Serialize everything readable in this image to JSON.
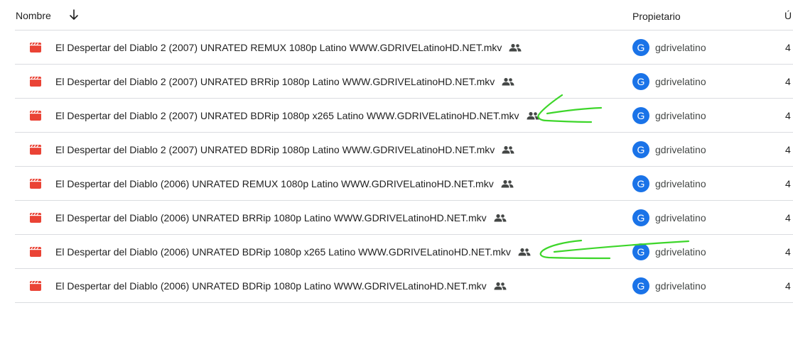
{
  "header": {
    "name_label": "Nombre",
    "sort_icon": "arrow-down-icon",
    "owner_label": "Propietario",
    "last_label": "Ú"
  },
  "files": [
    {
      "name": "El Despertar del Diablo 2 (2007) UNRATED REMUX 1080p Latino WWW.GDRIVELatinoHD.NET.mkv",
      "owner": "gdrivelatino",
      "avatar_letter": "G",
      "last": "4"
    },
    {
      "name": "El Despertar del Diablo 2 (2007) UNRATED BRRip 1080p Latino WWW.GDRIVELatinoHD.NET.mkv",
      "owner": "gdrivelatino",
      "avatar_letter": "G",
      "last": "4"
    },
    {
      "name": "El Despertar del Diablo 2 (2007) UNRATED BDRip 1080p x265 Latino WWW.GDRIVELatinoHD.NET.mkv",
      "owner": "gdrivelatino",
      "avatar_letter": "G",
      "last": "4"
    },
    {
      "name": "El Despertar del Diablo 2 (2007) UNRATED BDRip 1080p Latino WWW.GDRIVELatinoHD.NET.mkv",
      "owner": "gdrivelatino",
      "avatar_letter": "G",
      "last": "4"
    },
    {
      "name": "El Despertar del Diablo (2006) UNRATED REMUX 1080p Latino WWW.GDRIVELatinoHD.NET.mkv",
      "owner": "gdrivelatino",
      "avatar_letter": "G",
      "last": "4"
    },
    {
      "name": "El Despertar del Diablo (2006) UNRATED BRRip 1080p Latino WWW.GDRIVELatinoHD.NET.mkv",
      "owner": "gdrivelatino",
      "avatar_letter": "G",
      "last": "4"
    },
    {
      "name": "El Despertar del Diablo (2006) UNRATED BDRip 1080p x265 Latino WWW.GDRIVELatinoHD.NET.mkv",
      "owner": "gdrivelatino",
      "avatar_letter": "G",
      "last": "4"
    },
    {
      "name": "El Despertar del Diablo (2006) UNRATED BDRip 1080p Latino WWW.GDRIVELatinoHD.NET.mkv",
      "owner": "gdrivelatino",
      "avatar_letter": "G",
      "last": "4"
    }
  ],
  "icons": {
    "file_icon": "video-file-icon",
    "shared_icon": "shared-people-icon"
  },
  "colors": {
    "video_icon": "#ea4335",
    "avatar": "#1a73e8",
    "annotation": "#3dd62a",
    "divider": "#dadce0"
  }
}
